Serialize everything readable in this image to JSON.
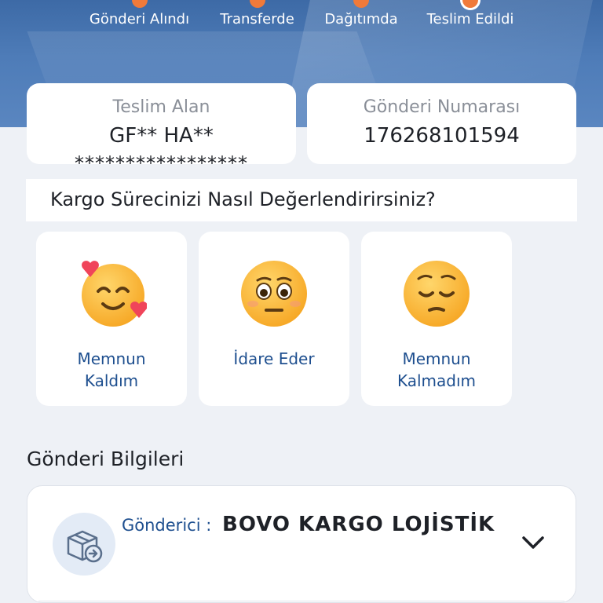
{
  "steps": [
    {
      "label": "Gönderi Alındı"
    },
    {
      "label": "Transferde"
    },
    {
      "label": "Dağıtımda"
    },
    {
      "label": "Teslim Edildi"
    }
  ],
  "receiver": {
    "label": "Teslim Alan",
    "name": "GF** HA**",
    "masked": "*****************"
  },
  "shipment": {
    "label": "Gönderi Numarası",
    "number": "176268101594"
  },
  "rating": {
    "question": "Kargo Sürecinizi Nasıl Değerlendirirsiniz?",
    "options": [
      {
        "label_line1": "Memnun",
        "label_line2": "Kaldım",
        "icon": "smiling-face-with-hearts-icon"
      },
      {
        "label_line1": "İdare Eder",
        "label_line2": "",
        "icon": "flushed-face-icon"
      },
      {
        "label_line1": "Memnun",
        "label_line2": "Kalmadım",
        "icon": "pensive-face-icon"
      }
    ]
  },
  "section": {
    "title": "Gönderi Bilgileri"
  },
  "sender": {
    "label": "Gönderici :",
    "name": "BOVO KARGO LOJİSTİK",
    "icon": "package-arrow-icon",
    "toggle_icon": "chevron-down-icon"
  },
  "colors": {
    "accent": "#f07a3a",
    "brand_blue": "#1e4f8f",
    "hero": "#4e7cb8"
  }
}
